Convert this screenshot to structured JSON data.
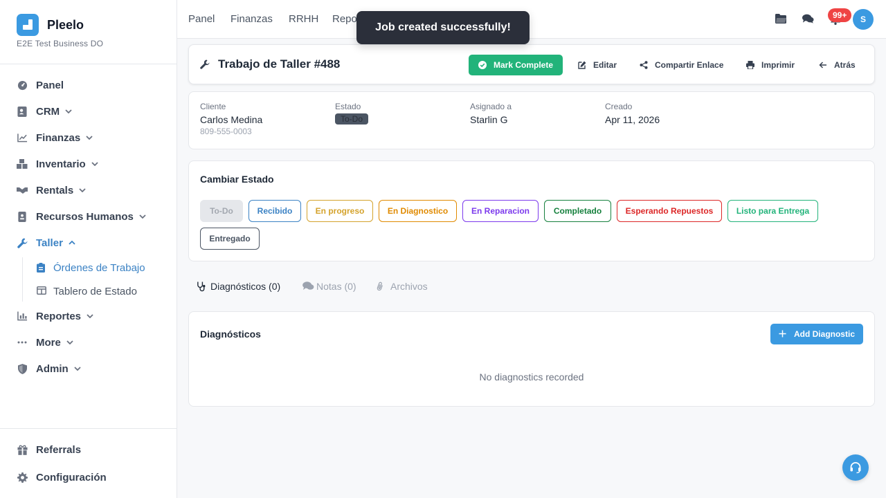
{
  "brand": {
    "name": "Pleelo",
    "business": "E2E Test Business DO"
  },
  "sidebar": {
    "items": [
      {
        "label": "Panel",
        "icon": "dashboard-icon"
      },
      {
        "label": "CRM",
        "icon": "contacts-icon"
      },
      {
        "label": "Finanzas",
        "icon": "chart-line-icon"
      },
      {
        "label": "Inventario",
        "icon": "boxes-icon"
      },
      {
        "label": "Rentals",
        "icon": "handshake-icon"
      },
      {
        "label": "Recursos Humanos",
        "icon": "id-badge-icon"
      },
      {
        "label": "Taller",
        "icon": "wrench-icon"
      },
      {
        "label": "Reportes",
        "icon": "bar-chart-icon"
      },
      {
        "label": "More",
        "icon": "ellipsis-icon"
      },
      {
        "label": "Admin",
        "icon": "shield-icon"
      }
    ],
    "subitems": [
      {
        "label": "Órdenes de Trabajo",
        "icon": "clipboard-icon"
      },
      {
        "label": "Tablero de Estado",
        "icon": "board-icon"
      }
    ],
    "bottom": [
      {
        "label": "Referrals",
        "icon": "gift-icon"
      },
      {
        "label": "Configuración",
        "icon": "gear-icon"
      }
    ]
  },
  "topbar": {
    "links": [
      "Panel",
      "Finanzas",
      "RRHH",
      "Reportes"
    ],
    "notifications_count": "99+",
    "avatar_initial": "S"
  },
  "toast": {
    "message": "Job created successfully!"
  },
  "job": {
    "title": "Trabajo de Taller #488",
    "actions": {
      "complete": "Mark Complete",
      "edit": "Editar",
      "share": "Compartir Enlace",
      "print": "Imprimir",
      "back": "Atrás"
    },
    "info": {
      "client_label": "Cliente",
      "client_name": "Carlos Medina",
      "client_phone": "809-555-0003",
      "status_label": "Estado",
      "status_value": "To-Do",
      "assigned_label": "Asignado a",
      "assigned_value": "Starlin G",
      "created_label": "Creado",
      "created_value": "Apr 11, 2026"
    }
  },
  "status_change": {
    "title": "Cambiar Estado",
    "options": [
      {
        "label": "To-Do",
        "color": "#9ca3af"
      },
      {
        "label": "Recibido",
        "color": "#3b82c4"
      },
      {
        "label": "En progreso",
        "color": "#d4a22b"
      },
      {
        "label": "En Diagnostico",
        "color": "#e08a00"
      },
      {
        "label": "En Reparacion",
        "color": "#7c3aed"
      },
      {
        "label": "Completado",
        "color": "#15803d"
      },
      {
        "label": "Esperando Repuestos",
        "color": "#dc2626"
      },
      {
        "label": "Listo para Entrega",
        "color": "#22b37a"
      },
      {
        "label": "Entregado",
        "color": "#4b5563"
      }
    ]
  },
  "tabs": [
    {
      "label": "Diagnósticos (0)",
      "icon": "stethoscope-icon"
    },
    {
      "label": "Notas (0)",
      "icon": "comments-icon"
    },
    {
      "label": "Archivos",
      "icon": "paperclip-icon"
    }
  ],
  "diagnostics": {
    "title": "Diagnósticos",
    "add_label": "Add Diagnostic",
    "empty": "No diagnostics recorded"
  },
  "colors": {
    "accent": "#3b9ae1",
    "success": "#22b37a",
    "danger": "#ef4444"
  }
}
